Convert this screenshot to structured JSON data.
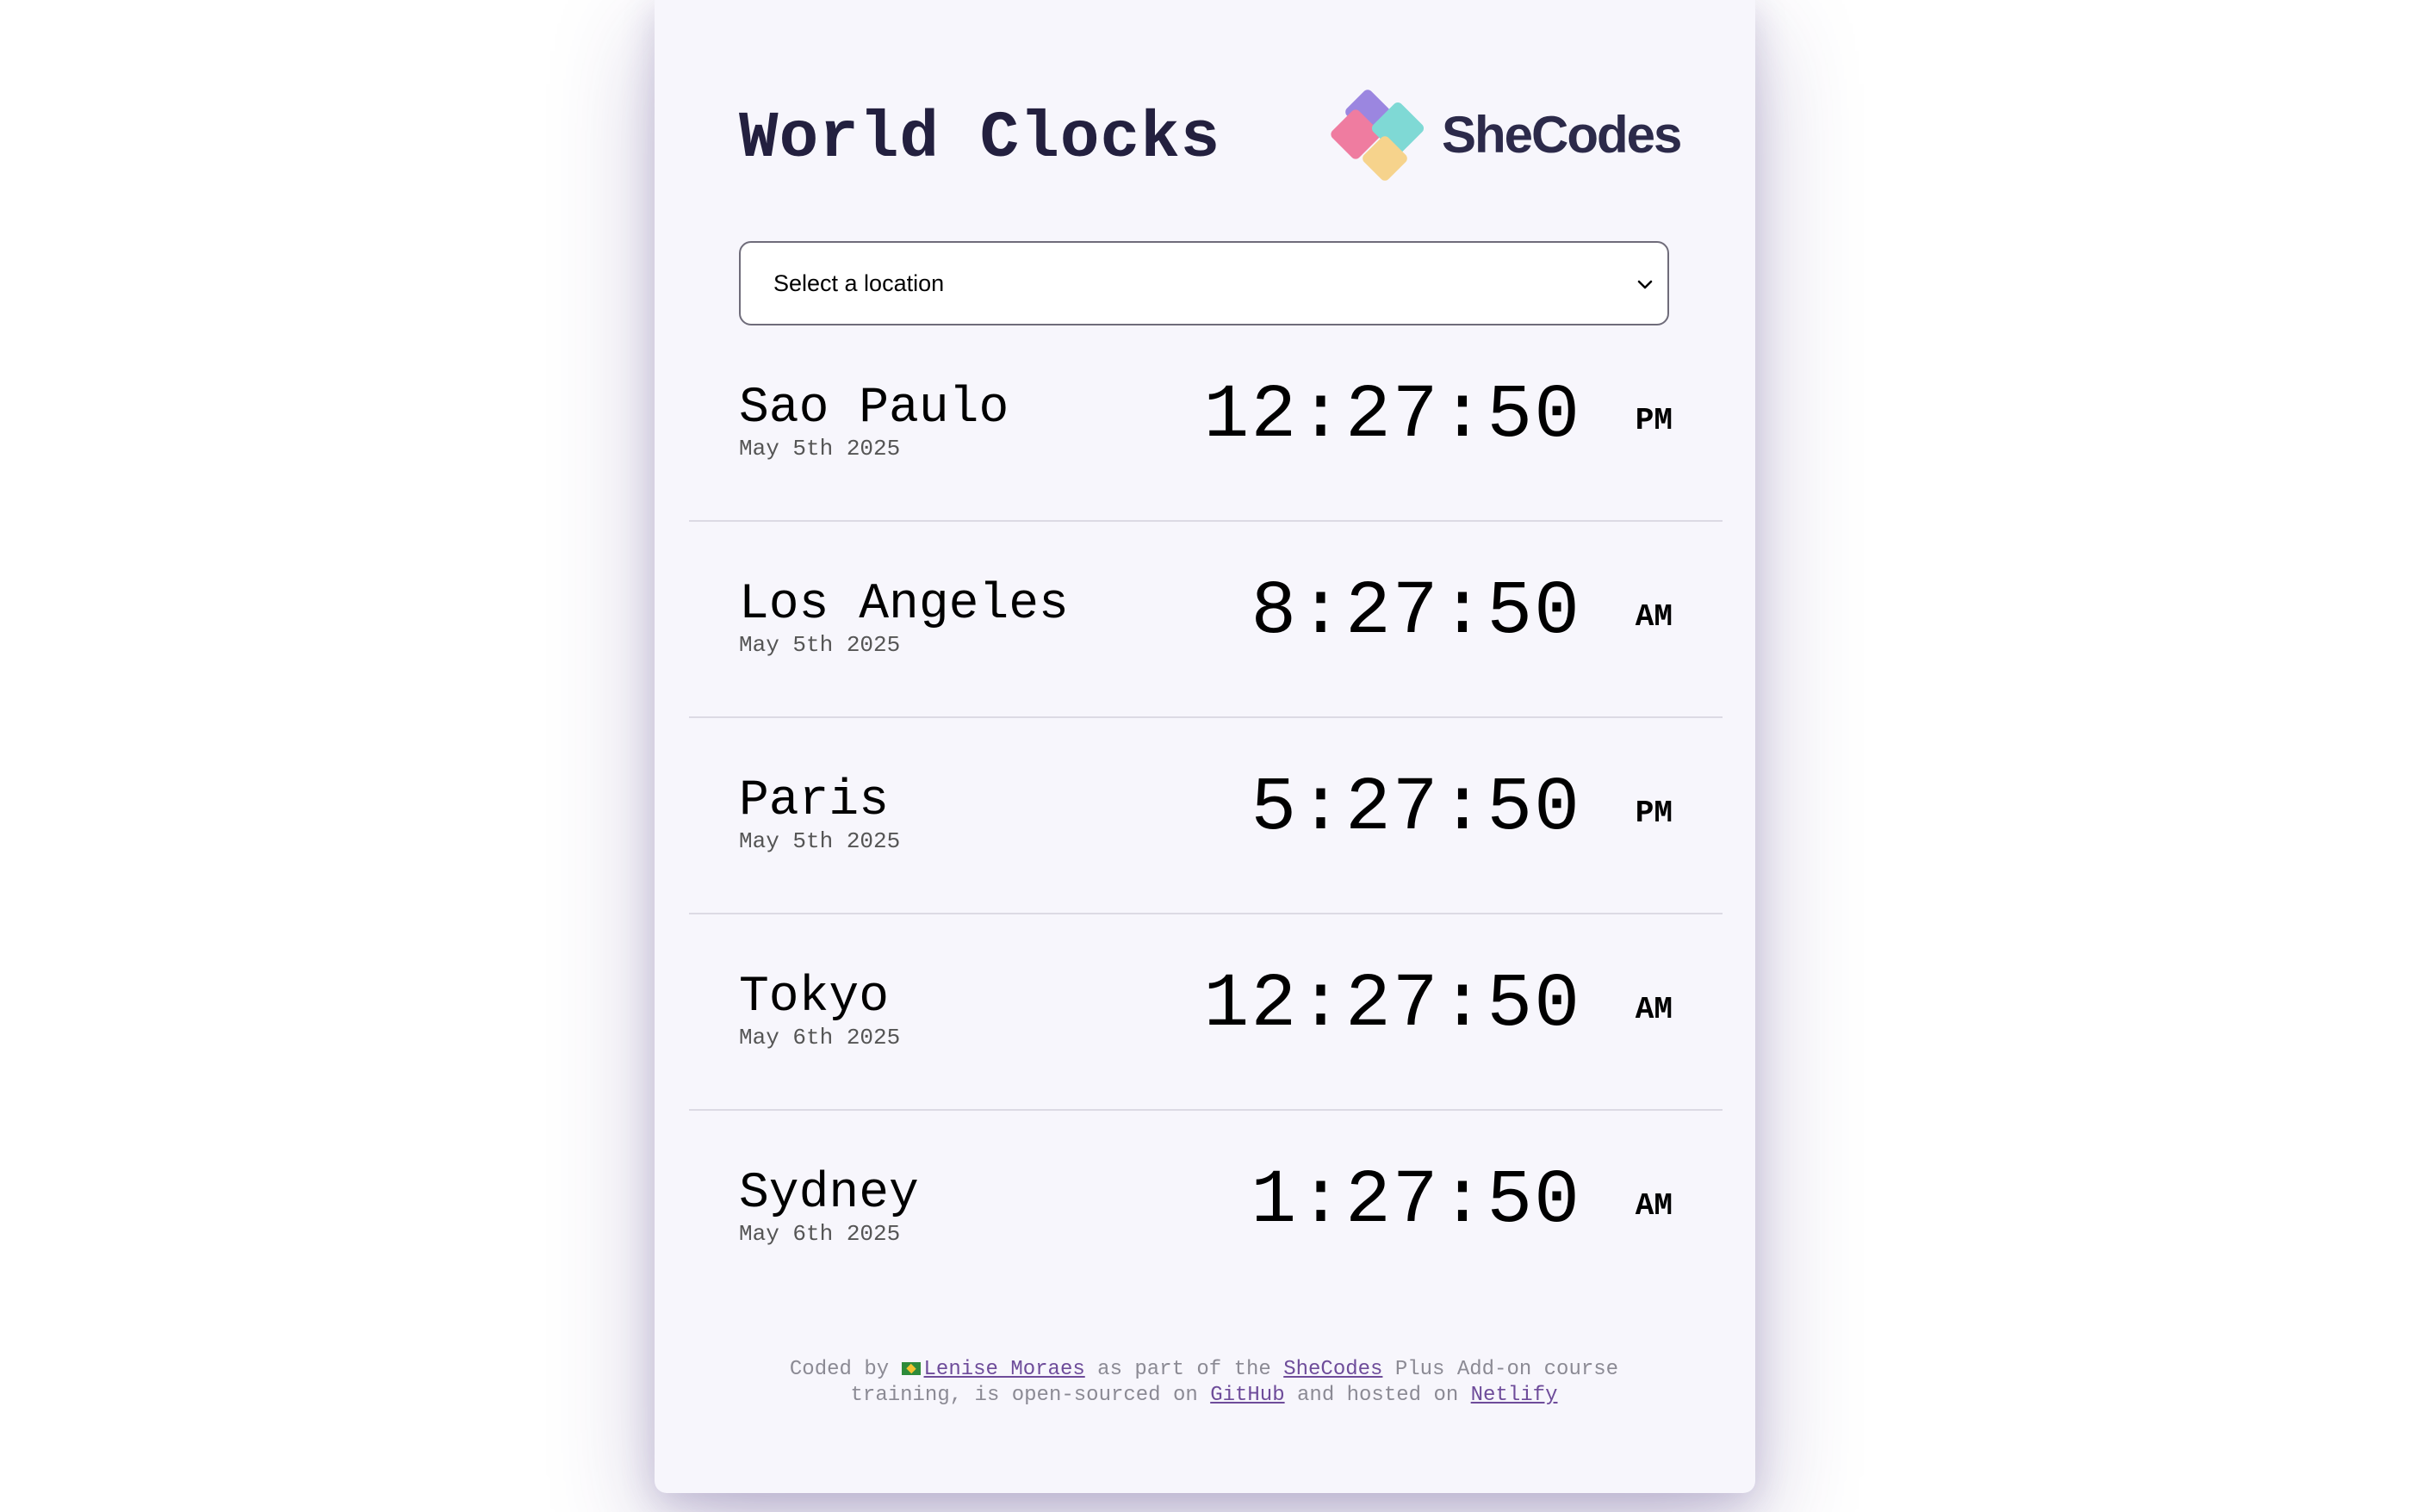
{
  "header": {
    "title": "World Clocks",
    "logo_text": "SheCodes"
  },
  "location_select": {
    "selected": "Select a location"
  },
  "cities": [
    {
      "name": "Sao Paulo",
      "date": "May 5th 2025",
      "time": "12:27:50",
      "ampm": "PM"
    },
    {
      "name": "Los Angeles",
      "date": "May 5th 2025",
      "time": "8:27:50",
      "ampm": "AM"
    },
    {
      "name": "Paris",
      "date": "May 5th 2025",
      "time": "5:27:50",
      "ampm": "PM"
    },
    {
      "name": "Tokyo",
      "date": "May 6th 2025",
      "time": "12:27:50",
      "ampm": "AM"
    },
    {
      "name": "Sydney",
      "date": "May 6th 2025",
      "time": "1:27:50",
      "ampm": "AM"
    }
  ],
  "footer": {
    "t1": "Coded by ",
    "author": "Lenise Moraes",
    "t2": " as part of the ",
    "shecodes": "SheCodes",
    "t3": " Plus Add-on course",
    "t4": "training, is open-sourced on ",
    "github": "GitHub",
    "t5": " and hosted on ",
    "netlify": "Netlify"
  },
  "colors": {
    "card_bg": "#f7f6fc",
    "title": "#23203f",
    "link": "#6e4c9a"
  }
}
